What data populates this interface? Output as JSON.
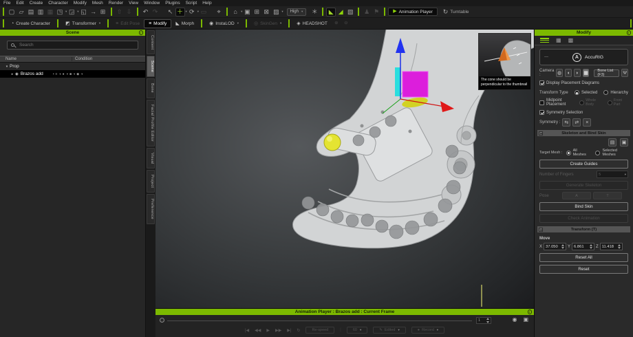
{
  "accent": "#7cb900",
  "menu": {
    "items": [
      "File",
      "Edit",
      "Create",
      "Character",
      "Modify",
      "Mesh",
      "Render",
      "View",
      "Window",
      "Plugins",
      "Script",
      "Help"
    ]
  },
  "toolbar": {
    "file_icons": [
      "▢",
      "▱",
      "▤",
      "▥",
      "▦",
      "◳",
      "◲",
      "◱",
      "→"
    ],
    "transfer_icons": [
      "⇧",
      "⇩"
    ],
    "undo_icon": "↶",
    "redo_icon": "↷",
    "select_icon": "↖",
    "move_icon": "＋",
    "rotate_icon": "⟳",
    "scale_icon": "▭",
    "focus_icon": "⌖",
    "home_icon": "⌂",
    "view_icons": [
      "▣",
      "⊞",
      "⊠",
      "▨"
    ],
    "quality_value": "High",
    "burst_icon": "＊",
    "display_icons": [
      "◣",
      "◢",
      "▧"
    ],
    "misc_icons": [
      "♟",
      "⚑"
    ],
    "animation_player": {
      "icon": "▶",
      "label": "Animation Player"
    },
    "turntable": {
      "icon": "↻",
      "label": "Turntable"
    }
  },
  "mode_bar": {
    "create_character": {
      "icon": "◔",
      "label": "Create Character"
    },
    "transformer": {
      "icon": "◩",
      "label": "Transformer"
    },
    "edit_pose": {
      "icon": "≡",
      "label": "Edit Pose"
    },
    "modify": {
      "icon": "≡",
      "label": "Modify"
    },
    "morph": {
      "icon": "◣",
      "label": "Morph"
    },
    "instalod": {
      "icon": "◉",
      "label": "InstaLOD"
    },
    "skingen": {
      "icon": "◎",
      "label": "SkinGen"
    },
    "headshot": {
      "icon": "◈",
      "label": "HEADSHOT"
    },
    "extra_icons": [
      "⊕",
      "⊖"
    ]
  },
  "scene_panel": {
    "title": "Scene",
    "search_placeholder": "Search",
    "columns": [
      "Name",
      "Condition"
    ],
    "group_row": {
      "arrow": "▾",
      "label": "Prop"
    },
    "item_row": {
      "arrow": "▸",
      "eye_icon": "◉",
      "label": "Brazos add",
      "condition_icons": [
        "▪",
        "≡",
        "●",
        "■",
        "◆"
      ]
    }
  },
  "side_tabs": {
    "items": [
      "Content",
      "Scene",
      "Bone",
      "Facial Profile Editor",
      "Visual",
      "Project",
      "Preference"
    ]
  },
  "viewport": {
    "hint_caption": "The cone should be perpendicular to the thumbnail"
  },
  "modify_panel": {
    "title": "Modify",
    "rig_collapse": "—",
    "rig_logo_letter": "A",
    "rig_name": "AccuRIG",
    "camera_label": "Camera :",
    "camera_icons": [
      "◍",
      "◖",
      "◗",
      "▦"
    ],
    "bone_list_button": "Bone List (F3)",
    "skeleton_icon": "Ψ",
    "display_placement_label": "Display Placement Diagrams",
    "transform_type_label": "Transform Type",
    "transform_type_options": [
      "Selected",
      "Hierarchy"
    ],
    "midpoint_label": "Midpoint Placement",
    "midpoint_options": [
      "Whole Body",
      "Front Part"
    ],
    "symmetry_selection_label": "Symmetry Selection",
    "symmetry_label": "Symmetry :",
    "symmetry_icons": [
      "⇆",
      "⇄",
      "×"
    ],
    "skeleton_section_title": "Skeleton and Bind Skin",
    "file_icons": [
      "▤",
      "▣"
    ],
    "target_mesh_label": "Target Mesh :",
    "target_mesh_options": [
      "All Meshes",
      "Selected Meshes"
    ],
    "create_guides_button": "Create Guides",
    "fingers_label": "Number of Fingers",
    "fingers_value": "5",
    "generate_skeleton_button": "Generate Skeleton",
    "pose_label": "Pose",
    "pose_buttons": [
      "A",
      "T"
    ],
    "bind_skin_button": "Bind Skin",
    "check_animation_button": "Check Animation",
    "transform_section_title": "Transform (T)",
    "move_label": "Move",
    "axes": {
      "x_label": "X",
      "x": "37.050",
      "y_label": "Y",
      "y": "6.861",
      "z_label": "Z",
      "z": "11.418"
    },
    "reset_all_button": "Reset All",
    "reset_button": "Reset"
  },
  "animation_player": {
    "title": "Animation Player : Brazos add : Current Frame",
    "frame_value": "1",
    "render_icon": "◉",
    "snapshot_icon": "▣",
    "transport_icons": [
      "|◀",
      "◀◀",
      "▶",
      "▶▶",
      "▶|"
    ],
    "loop_icon": "↻",
    "respeed_button": "Re-speed",
    "fps_value": "60",
    "edit_icon": "✎",
    "edited_label": "Edited",
    "record_icon": "●",
    "record_label": "Record"
  }
}
